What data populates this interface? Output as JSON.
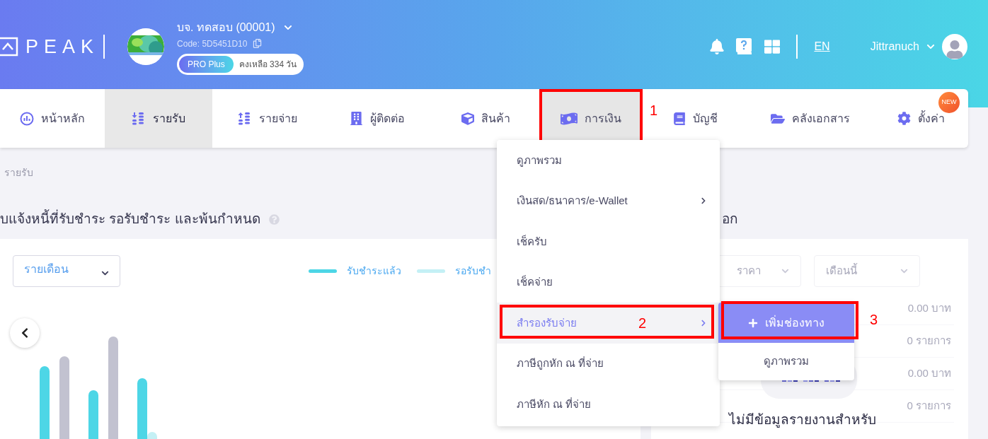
{
  "header": {
    "logo": "PEAK",
    "company": {
      "name": "บจ. ทดสอบ (00001)",
      "code": "Code: 5D5451D10",
      "plan": "PRO Plus",
      "remaining": "คงเหลือ 334 วัน"
    },
    "language": "EN",
    "user": "Jittranuch"
  },
  "nav": [
    {
      "label": "หน้าหลัก",
      "selected": false,
      "expanded": false
    },
    {
      "label": "รายรับ",
      "selected": true,
      "expanded": false
    },
    {
      "label": "รายจ่าย",
      "selected": false,
      "expanded": false
    },
    {
      "label": "ผู้ติดต่อ",
      "selected": false,
      "expanded": false
    },
    {
      "label": "สินค้า",
      "selected": false,
      "expanded": false
    },
    {
      "label": "การเงิน",
      "selected": false,
      "expanded": true,
      "annotation": "1"
    },
    {
      "label": "บัญชี",
      "selected": false,
      "expanded": false
    },
    {
      "label": "คลังเอกสาร",
      "selected": false,
      "expanded": false
    },
    {
      "label": "ตั้งค่า",
      "selected": false,
      "expanded": false,
      "badge": "NEW"
    }
  ],
  "breadcrumb": "รายรับ",
  "invoice_section": {
    "title": "บแจ้งหนี้ที่รับชำระ รอรับชำระ และพ้นกำหนด",
    "period": "รายเดือน",
    "legend": [
      {
        "label": "รับชำระแล้ว",
        "color": "#4dd6e6"
      },
      {
        "label": "รอรับชำ",
        "color": "#c4f0f5"
      }
    ]
  },
  "summary_section": {
    "title": "อก",
    "filters": [
      "ราคา",
      "เดือนนี้"
    ],
    "rows": [
      {
        "value": "0.00 บาท"
      },
      {
        "value": "0 รายการ"
      },
      {
        "value": "0.00 บาท"
      },
      {
        "value": "0 รายการ"
      }
    ],
    "empty_message": "ไม่มีข้อมูลรายงานสำหรับ"
  },
  "finance_menu": [
    {
      "label": "ดูภาพรวม",
      "submenu": false,
      "selected": false
    },
    {
      "label": "เงินสด/ธนาคาร/e-Wallet",
      "submenu": true,
      "selected": false
    },
    {
      "label": "เช็ครับ",
      "submenu": false,
      "selected": false
    },
    {
      "label": "เช็คจ่าย",
      "submenu": false,
      "selected": false
    },
    {
      "label": "สำรองรับจ่าย",
      "submenu": true,
      "selected": true,
      "annotation": "2"
    },
    {
      "label": "ภาษีถูกหัก ณ ที่จ่าย",
      "submenu": false,
      "selected": false
    },
    {
      "label": "ภาษีหัก ณ ที่จ่าย",
      "submenu": false,
      "selected": false
    }
  ],
  "submenu": [
    {
      "kind": "primary",
      "label": "เพิ่มช่องทาง",
      "annotation": "3"
    },
    {
      "kind": "link",
      "label": "ดูภาพรวม"
    }
  ]
}
